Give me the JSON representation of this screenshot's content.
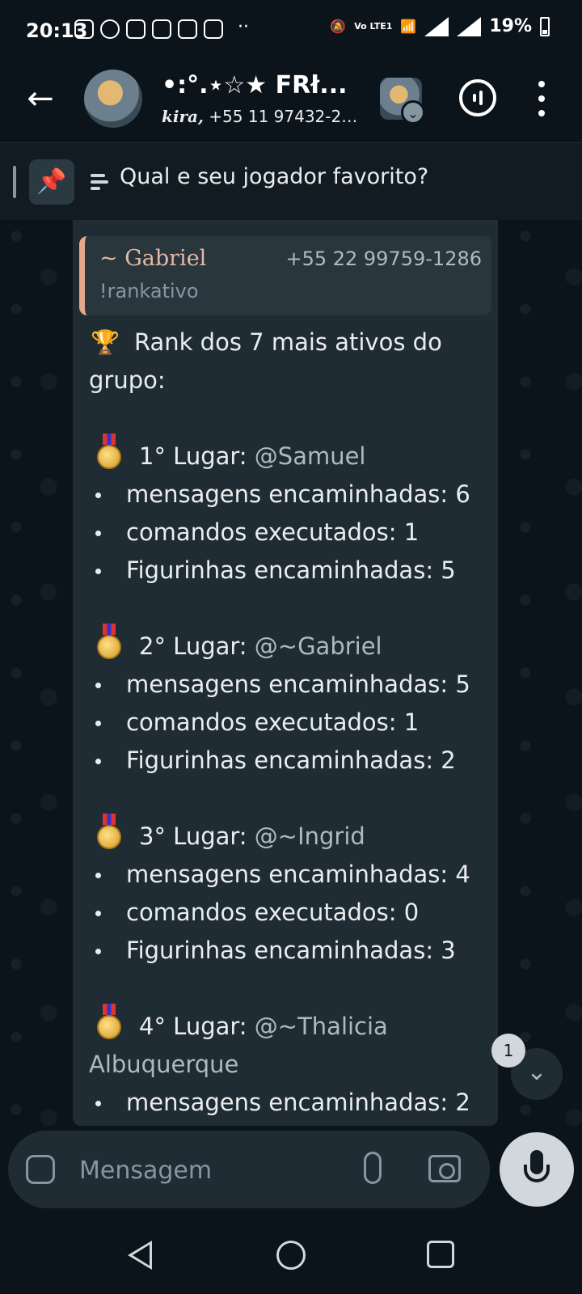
{
  "status_bar": {
    "time": "20:13",
    "network_label": "Vo LTE1",
    "battery": "19%"
  },
  "header": {
    "title": "•:°.⋆☆★ FRł...",
    "subtitle_bold": "kira,",
    "subtitle_rest": " +55 11 97432-20..."
  },
  "pinned": {
    "text": "Qual e seu jogador favorito?"
  },
  "message": {
    "quote": {
      "name": "~ Gabriel",
      "phone": "+55 22 99759-1286",
      "text": "!rankativo"
    },
    "header_line1": "Rank dos 7 mais ativos do",
    "header_line2": "grupo:",
    "trophy_emoji": "🏆",
    "ranks": [
      {
        "place": "1° Lugar: ",
        "mention": "@Samuel",
        "mention_cont": "",
        "stats": [
          "mensagens encaminhadas: 6",
          "comandos executados: 1",
          "Figurinhas encaminhadas: 5"
        ]
      },
      {
        "place": "2° Lugar: ",
        "mention": "@~Gabriel",
        "mention_cont": "",
        "stats": [
          "mensagens encaminhadas: 5",
          "comandos executados: 1",
          "Figurinhas encaminhadas: 2"
        ]
      },
      {
        "place": "3° Lugar: ",
        "mention": "@~Ingrid",
        "mention_cont": "",
        "stats": [
          "mensagens encaminhadas: 4",
          "comandos executados: 0",
          "Figurinhas encaminhadas: 3"
        ]
      },
      {
        "place": "4° Lugar: ",
        "mention": "@~Thalicia",
        "mention_cont": "Albuquerque",
        "stats": [
          "mensagens encaminhadas: 2"
        ]
      }
    ]
  },
  "scroll": {
    "unread_count": "1"
  },
  "input": {
    "placeholder": "Mensagem"
  },
  "icons": {
    "back": "arrow-left-icon",
    "voice_chat": "voice-chat-icon",
    "menu": "more-vert-icon",
    "pin": "pin-icon",
    "poll": "poll-icon",
    "sticker": "sticker-icon",
    "attach": "paperclip-icon",
    "camera": "camera-icon",
    "mic": "microphone-icon",
    "scroll_down": "double-chevron-down-icon"
  },
  "colors": {
    "background": "#0b141a",
    "bubble": "#202c33",
    "quote_accent": "#e5a88a",
    "text": "#e9edef"
  }
}
